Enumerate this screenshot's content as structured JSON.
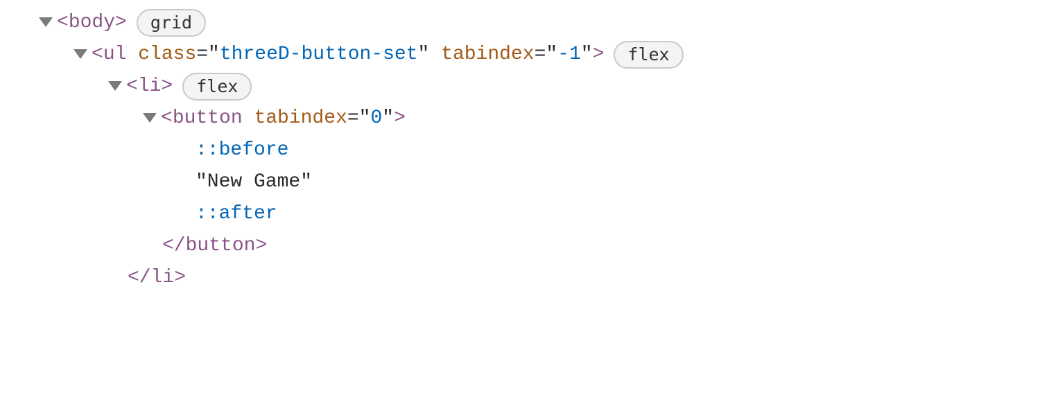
{
  "lines": {
    "l0": {
      "tag": "body",
      "badge": "grid"
    },
    "l1": {
      "tag": "ul",
      "attrs": [
        {
          "name": "class",
          "value": "threeD-button-set"
        },
        {
          "name": "tabindex",
          "value": "-1"
        }
      ],
      "badge": "flex"
    },
    "l2": {
      "tag": "li",
      "badge": "flex"
    },
    "l3": {
      "tag": "button",
      "attrs": [
        {
          "name": "tabindex",
          "value": "0"
        }
      ]
    },
    "l4": {
      "pseudo": "::before"
    },
    "l5": {
      "text": "\"New Game\""
    },
    "l6": {
      "pseudo": "::after"
    },
    "l7": {
      "close_tag": "button"
    },
    "l8": {
      "close_tag": "li"
    }
  }
}
